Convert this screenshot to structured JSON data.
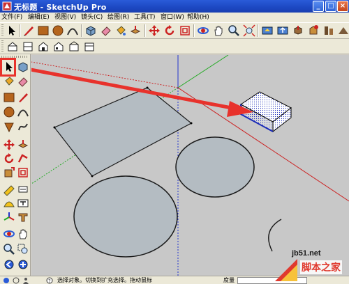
{
  "window": {
    "title": "无标题 - SketchUp Pro",
    "controls": {
      "minimize": "_",
      "maximize": "□",
      "close": "×"
    }
  },
  "menu": [
    {
      "label": "文件(F)"
    },
    {
      "label": "编辑(E)"
    },
    {
      "label": "视图(V)"
    },
    {
      "label": "镜头(C)"
    },
    {
      "label": "绘图(R)"
    },
    {
      "label": "工具(T)"
    },
    {
      "label": "窗口(W)"
    },
    {
      "label": "帮助(H)"
    }
  ],
  "toolbar_main": [
    "select-arrow-icon",
    "pencil-line-icon",
    "rectangle-icon",
    "circle-icon",
    "arc-icon",
    "make-component-icon",
    "eraser-icon",
    "paint-bucket-icon",
    "push-pull-icon",
    "move-icon",
    "rotate-icon",
    "offset-icon",
    "orbit-icon",
    "pan-hand-icon",
    "zoom-icon",
    "zoom-extents-icon",
    "get-models-icon",
    "share-model-icon",
    "share-component-icon",
    "extension-icon"
  ],
  "toolbar_views": [
    "iso-view-icon",
    "top-view-icon",
    "front-view-icon",
    "right-view-icon",
    "back-view-icon",
    "left-view-icon"
  ],
  "statusbar": {
    "hint": "选择对象。切换到扩充选择。拖动鼠标",
    "measure_label": "度量"
  },
  "watermark": {
    "url": "jb51.net",
    "site": "脚本之家"
  },
  "colors": {
    "titlebar": "#1c48c2",
    "chrome": "#ece9d8",
    "viewport_bg": "#c8c8c8",
    "face_fill": "#b4bcc2",
    "annotation_red": "#e8322c",
    "axis_red": "#cc2222",
    "axis_green": "#22aa22",
    "axis_blue": "#2233cc"
  }
}
